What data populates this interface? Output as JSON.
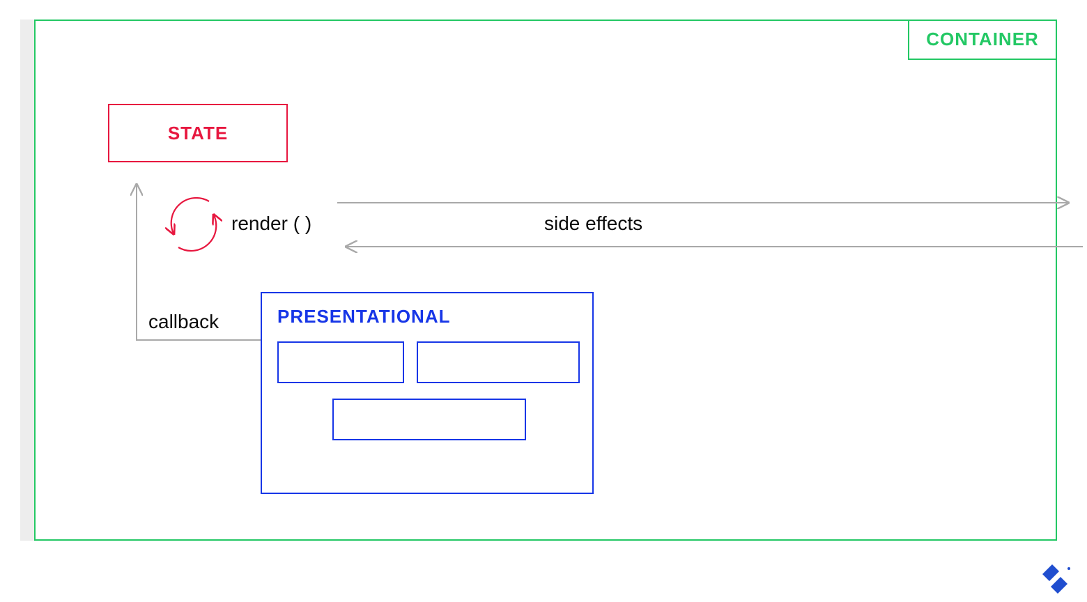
{
  "labels": {
    "container": "CONTAINER",
    "state": "STATE",
    "presentational": "PRESENTATIONAL",
    "render": "render ( )",
    "side_effects": "side effects",
    "callback": "callback"
  },
  "colors": {
    "green": "#23c864",
    "red": "#e7173f",
    "blue": "#1736e7",
    "grey_line": "#a9a9a9",
    "sidebar": "#ededed"
  }
}
